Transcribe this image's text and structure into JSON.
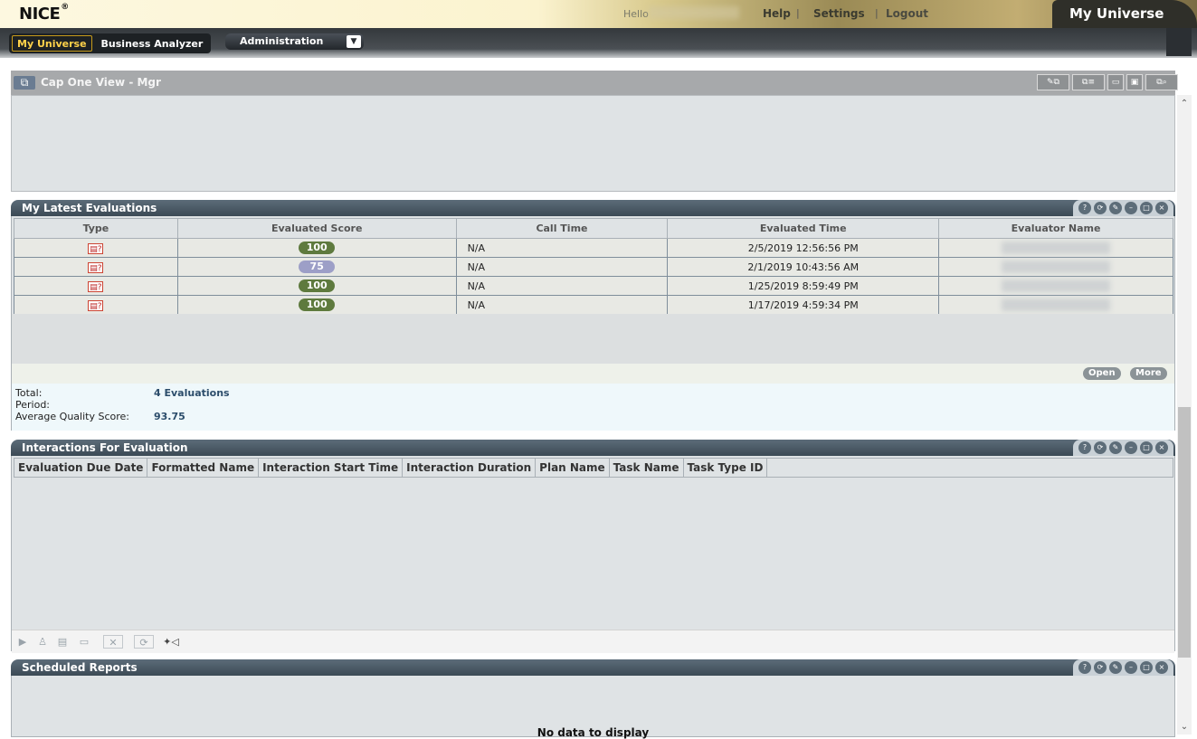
{
  "header": {
    "logo": "NICE",
    "logo_mark": "®",
    "hello": "Hello",
    "links": {
      "help": "Help",
      "settings": "Settings",
      "logout": "Logout"
    },
    "separator": "|",
    "brand": "My Universe"
  },
  "nav": {
    "tabs": [
      {
        "label": "My Universe",
        "active": true
      },
      {
        "label": "Business Analyzer",
        "active": false
      }
    ],
    "admin_menu": "Administration",
    "admin_arrow": "▼"
  },
  "page": {
    "title": "Cap One View - Mgr",
    "title_icon": "view-icon",
    "toolbar_icons": [
      "edit-view-icon",
      "manage-views-icon",
      "save-icon",
      "save-as-icon",
      "find-view-icon"
    ]
  },
  "portlet_icons": [
    "help-icon",
    "refresh-icon",
    "edit-icon",
    "minimize-icon",
    "maximize-icon",
    "close-icon"
  ],
  "evaluations": {
    "title": "My Latest Evaluations",
    "columns": [
      "Type",
      "Evaluated Score",
      "Call Time",
      "Evaluated Time",
      "Evaluator Name"
    ],
    "rows": [
      {
        "score": "100",
        "score_color": "#5e7a3e",
        "call_time": "N/A",
        "evaluated_time": "2/5/2019 12:56:56 PM"
      },
      {
        "score": "75",
        "score_color": "#9d9fc7",
        "call_time": "N/A",
        "evaluated_time": "2/1/2019 10:43:56 AM"
      },
      {
        "score": "100",
        "score_color": "#5e7a3e",
        "call_time": "N/A",
        "evaluated_time": "1/25/2019 8:59:49 PM"
      },
      {
        "score": "100",
        "score_color": "#5e7a3e",
        "call_time": "N/A",
        "evaluated_time": "1/17/2019 4:59:34 PM"
      }
    ],
    "buttons": {
      "open": "Open",
      "more": "More"
    },
    "summary": {
      "total_label": "Total:",
      "total_value": "4 Evaluations",
      "period_label": "Period:",
      "avg_label": "Average Quality Score:",
      "avg_value": "93.75"
    }
  },
  "interactions": {
    "title": "Interactions For Evaluation",
    "columns": [
      "Evaluation Due Date",
      "Formatted Name",
      "Interaction Start Time",
      "Interaction Duration",
      "Plan Name",
      "Task Name",
      "Task Type ID"
    ],
    "toolbar_icons": [
      "play-icon",
      "assign-icon",
      "copy-icon",
      "details-icon",
      "delete-icon",
      "refresh-icon",
      "media-icon"
    ]
  },
  "reports": {
    "title": "Scheduled Reports",
    "empty": "No data to display"
  },
  "scrollbar": {
    "up": "⌃",
    "down": "⌄"
  }
}
